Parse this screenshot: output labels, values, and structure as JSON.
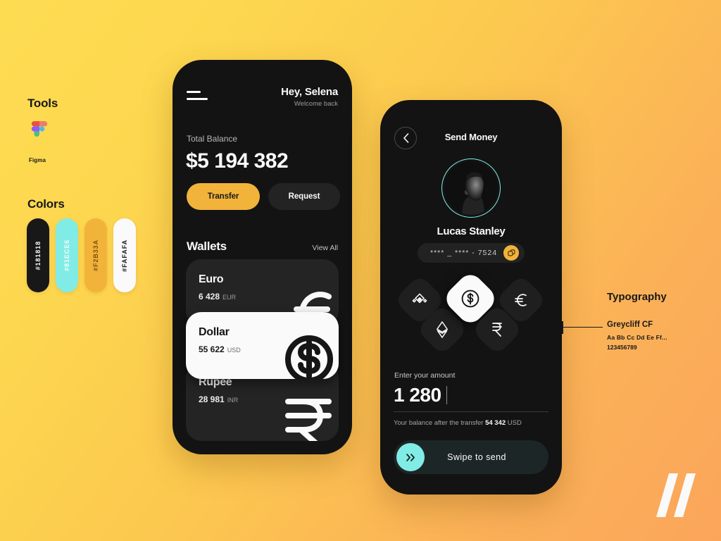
{
  "background": {
    "from": "#FDDC52",
    "to": "#FBA55B"
  },
  "palette": {
    "dark": "#181818",
    "mint": "#81ECE6",
    "amber": "#F2B33A",
    "white": "#FAFAFA"
  },
  "spec": {
    "tools_title": "Tools",
    "tool_name": "Figma",
    "tool_icon": "figma-icon",
    "colors_title": "Colors",
    "swatches": [
      {
        "hex": "#181818",
        "label": "#181818",
        "text_color": "#FAFAFA"
      },
      {
        "hex": "#81ECE6",
        "label": "#81ECE6",
        "text_color": "#FAFAFA"
      },
      {
        "hex": "#F2B33A",
        "label": "#F2B33A",
        "text_color": "#7a5410"
      },
      {
        "hex": "#FAFAFA",
        "label": "#FAFAFA",
        "text_color": "#181818"
      }
    ]
  },
  "typography": {
    "title": "Typography",
    "font_name": "Greycliff CF",
    "alphabet": "Aa Bb Cc Dd Ee Ff...",
    "numerals": "123456789"
  },
  "logo_icon": "double-slash-logo",
  "home_screen": {
    "menu_icon": "hamburger-menu-icon",
    "greeting": "Hey, Selena",
    "greeting_sub": "Welcome back",
    "balance_label": "Total Balance",
    "balance_amount": "$5 194 382",
    "transfer_label": "Transfer",
    "request_label": "Request",
    "wallets_title": "Wallets",
    "view_all_label": "View All",
    "wallets": [
      {
        "name": "Euro",
        "amount": "6 428",
        "currency": "EUR",
        "glyph_icon": "euro-sign-icon",
        "theme": "dark"
      },
      {
        "name": "Dollar",
        "amount": "55 622",
        "currency": "USD",
        "glyph_icon": "dollar-sign-icon",
        "theme": "light"
      },
      {
        "name": "Rupee",
        "amount": "28 981",
        "currency": "INR",
        "glyph_icon": "rupee-sign-icon",
        "theme": "dark"
      }
    ]
  },
  "send_screen": {
    "back_icon": "chevron-left-icon",
    "title": "Send Money",
    "avatar_icon": "contact-avatar",
    "contact_name": "Lucas Stanley",
    "card_number": "**** _ **** - 7524",
    "copy_icon": "copy-icon",
    "currencies": [
      {
        "key": "bnb",
        "icon": "binance-coin-icon",
        "selected": false
      },
      {
        "key": "eth",
        "icon": "ethereum-icon",
        "selected": false
      },
      {
        "key": "usd",
        "icon": "dollar-circle-icon",
        "selected": true
      },
      {
        "key": "inr",
        "icon": "rupee-icon",
        "selected": false
      },
      {
        "key": "eur",
        "icon": "euro-icon",
        "selected": false
      }
    ],
    "amount_label": "Enter your amount",
    "amount_value": "1 280",
    "balance_after_prefix": "Your balance after the transfer ",
    "balance_after_value": "54 342",
    "balance_after_unit": " USD",
    "swipe_label": "Swipe to  send",
    "swipe_icon": "double-chevron-right-icon"
  }
}
